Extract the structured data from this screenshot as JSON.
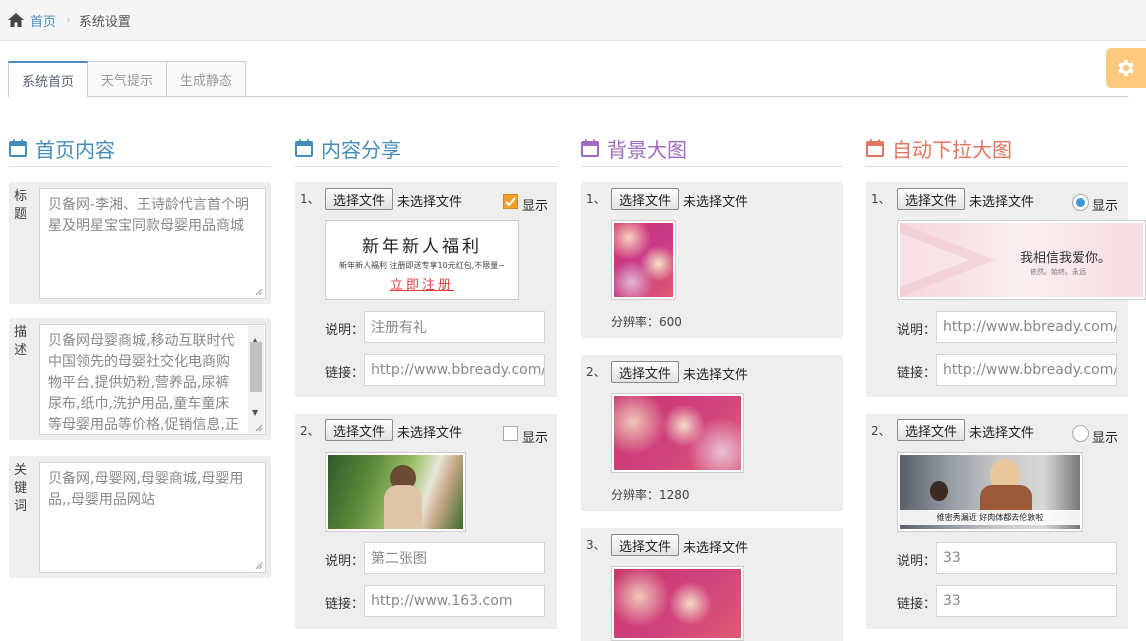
{
  "breadcrumb": {
    "home": "首页",
    "current": "系统设置"
  },
  "tabs": [
    "系统首页",
    "天气提示",
    "生成静态"
  ],
  "colors": {
    "blue": "#438eb9",
    "purple": "#a069c3",
    "orange": "#e2755f",
    "settings": "#ffb752"
  },
  "sections": {
    "homepage": {
      "title": "首页内容",
      "fields": [
        {
          "label": "标题",
          "value": "贝备网-李湘、王诗龄代言首个明星及明星宝宝同款母婴用品商城"
        },
        {
          "label": "描述",
          "value": "贝备网母婴商城,移动互联时代中国领先的母婴社交化电商购物平台,提供奶粉,营养品,尿裤尿布,纸巾,洗护用品,童车童床等母婴用品等价格,促销信息,正品保证,支持货到付款"
        },
        {
          "label": "关键词",
          "value": "贝备网,母婴网,母婴商城,母婴用品,,母婴用品网站"
        }
      ]
    },
    "share": {
      "title": "内容分享",
      "file_button": "选择文件",
      "no_file": "未选择文件",
      "show": "显示",
      "desc_label": "说明：",
      "link_label": "链接：",
      "items": [
        {
          "num": "1、",
          "checked": true,
          "banner_title": "新年新人福利",
          "banner_sub": "新年新人福利  注册即送专享10元红包,不限量~",
          "banner_cta": "立即注册",
          "desc": "注册有礼",
          "link": "http://www.bbready.com/"
        },
        {
          "num": "2、",
          "checked": false,
          "desc": "第二张图",
          "link": "http://www.163.com"
        }
      ]
    },
    "background": {
      "title": "背景大图",
      "file_button": "选择文件",
      "no_file": "未选择文件",
      "items": [
        {
          "num": "1、",
          "resolution": "分辨率：600"
        },
        {
          "num": "2、",
          "resolution": "分辨率：1280"
        },
        {
          "num": "3、"
        }
      ]
    },
    "dropdown": {
      "title": "自动下拉大图",
      "file_button": "选择文件",
      "no_file": "未选择文件",
      "show": "显示",
      "desc_label": "说明：",
      "link_label": "链接：",
      "items": [
        {
          "num": "1、",
          "checked": true,
          "banner_text": "我相信我爱你。",
          "banner_sub": "依然。始终。永远",
          "desc": "http://www.bbready.com/",
          "link": "http://www.bbready.com/"
        },
        {
          "num": "2、",
          "checked": false,
          "banner_caption": "维密秀漏近  好肉体都去伦敦啦",
          "desc": "33",
          "link": "33"
        }
      ]
    }
  }
}
